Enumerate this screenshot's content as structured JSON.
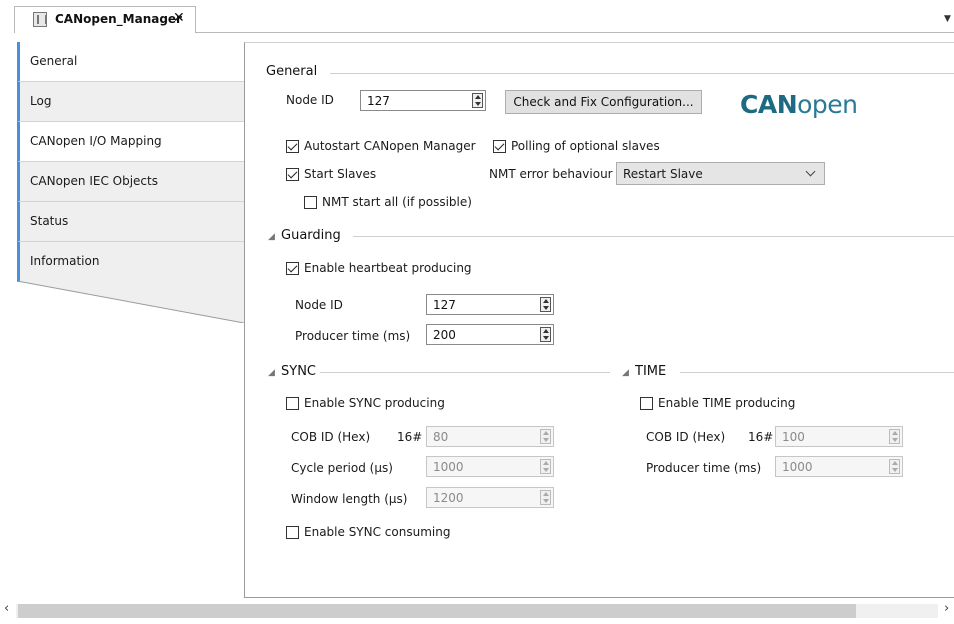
{
  "doc_tab": {
    "title": "CANopen_Manager",
    "close": "✕"
  },
  "side_tabs": [
    {
      "label": "General"
    },
    {
      "label": "Log"
    },
    {
      "label": "CANopen I/O Mapping"
    },
    {
      "label": "CANopen IEC Objects"
    },
    {
      "label": "Status"
    },
    {
      "label": "Information"
    }
  ],
  "general": {
    "section_title": "General",
    "node_id_label": "Node ID",
    "node_id_value": "127",
    "check_fix_button": "Check and Fix Configuration...",
    "autostart_label": "Autostart CANopen Manager",
    "autostart_checked": true,
    "polling_label": "Polling of optional slaves",
    "polling_checked": true,
    "start_slaves_label": "Start Slaves",
    "start_slaves_checked": true,
    "nmt_error_label": "NMT error behaviour",
    "nmt_error_value": "Restart Slave",
    "nmt_start_all_label": "NMT start all (if possible)",
    "nmt_start_all_checked": false
  },
  "logo": {
    "bold": "CAN",
    "thin": "open"
  },
  "guarding": {
    "section_title": "Guarding",
    "heartbeat_label": "Enable heartbeat producing",
    "heartbeat_checked": true,
    "node_id_label": "Node ID",
    "node_id_value": "127",
    "producer_time_label": "Producer time (ms)",
    "producer_time_value": "200"
  },
  "sync": {
    "section_title": "SYNC",
    "enable_producing_label": "Enable SYNC producing",
    "enable_producing_checked": false,
    "cob_id_label": "COB ID (Hex)",
    "cob_id_prefix": "16#",
    "cob_id_value": "80",
    "cycle_period_label": "Cycle period (µs)",
    "cycle_period_value": "1000",
    "window_length_label": "Window length (µs)",
    "window_length_value": "1200",
    "enable_consuming_label": "Enable SYNC consuming",
    "enable_consuming_checked": false
  },
  "time": {
    "section_title": "TIME",
    "enable_producing_label": "Enable TIME producing",
    "enable_producing_checked": false,
    "cob_id_label": "COB ID (Hex)",
    "cob_id_prefix": "16#",
    "cob_id_value": "100",
    "producer_time_label": "Producer time (ms)",
    "producer_time_value": "1000"
  },
  "scrollbar": {
    "left": "‹",
    "right": "›"
  }
}
